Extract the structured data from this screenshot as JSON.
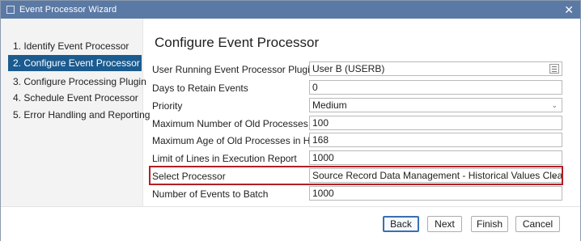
{
  "window": {
    "title": "Event Processor Wizard"
  },
  "steps": [
    {
      "label": "1. Identify Event Processor",
      "active": false
    },
    {
      "label": "2. Configure Event Processor",
      "active": true
    },
    {
      "label": "3. Configure Processing Plugin",
      "active": false
    },
    {
      "label": "4. Schedule Event Processor",
      "active": false
    },
    {
      "label": "5. Error Handling and Reporting",
      "active": false
    }
  ],
  "page": {
    "heading": "Configure Event Processor"
  },
  "form": {
    "user_running": {
      "label": "User Running Event Processor Plugin",
      "value": "User B (USERB)"
    },
    "days_retain": {
      "label": "Days to Retain Events",
      "value": "0"
    },
    "priority": {
      "label": "Priority",
      "value": "Medium"
    },
    "max_old_processes": {
      "label": "Maximum Number of Old Processes",
      "value": "100"
    },
    "max_age_hours": {
      "label": "Maximum Age of Old Processes in Hours",
      "value": "168"
    },
    "limit_lines": {
      "label": "Limit of Lines in Execution Report",
      "value": "1000"
    },
    "select_processor": {
      "label": "Select Processor",
      "value": "Source Record Data Management - Historical Values Cleanup"
    },
    "events_to_batch": {
      "label": "Number of Events to Batch",
      "value": "1000"
    }
  },
  "buttons": {
    "back": "Back",
    "next": "Next",
    "finish": "Finish",
    "cancel": "Cancel"
  },
  "colors": {
    "titlebar": "#5b79a5",
    "active_step": "#1b5b8f",
    "highlight": "#b21f24",
    "primary_border": "#3a6fb3"
  },
  "icons": {
    "close": "close-icon",
    "lookup": "lookup-icon",
    "dropdown": "chevron-down-icon"
  }
}
